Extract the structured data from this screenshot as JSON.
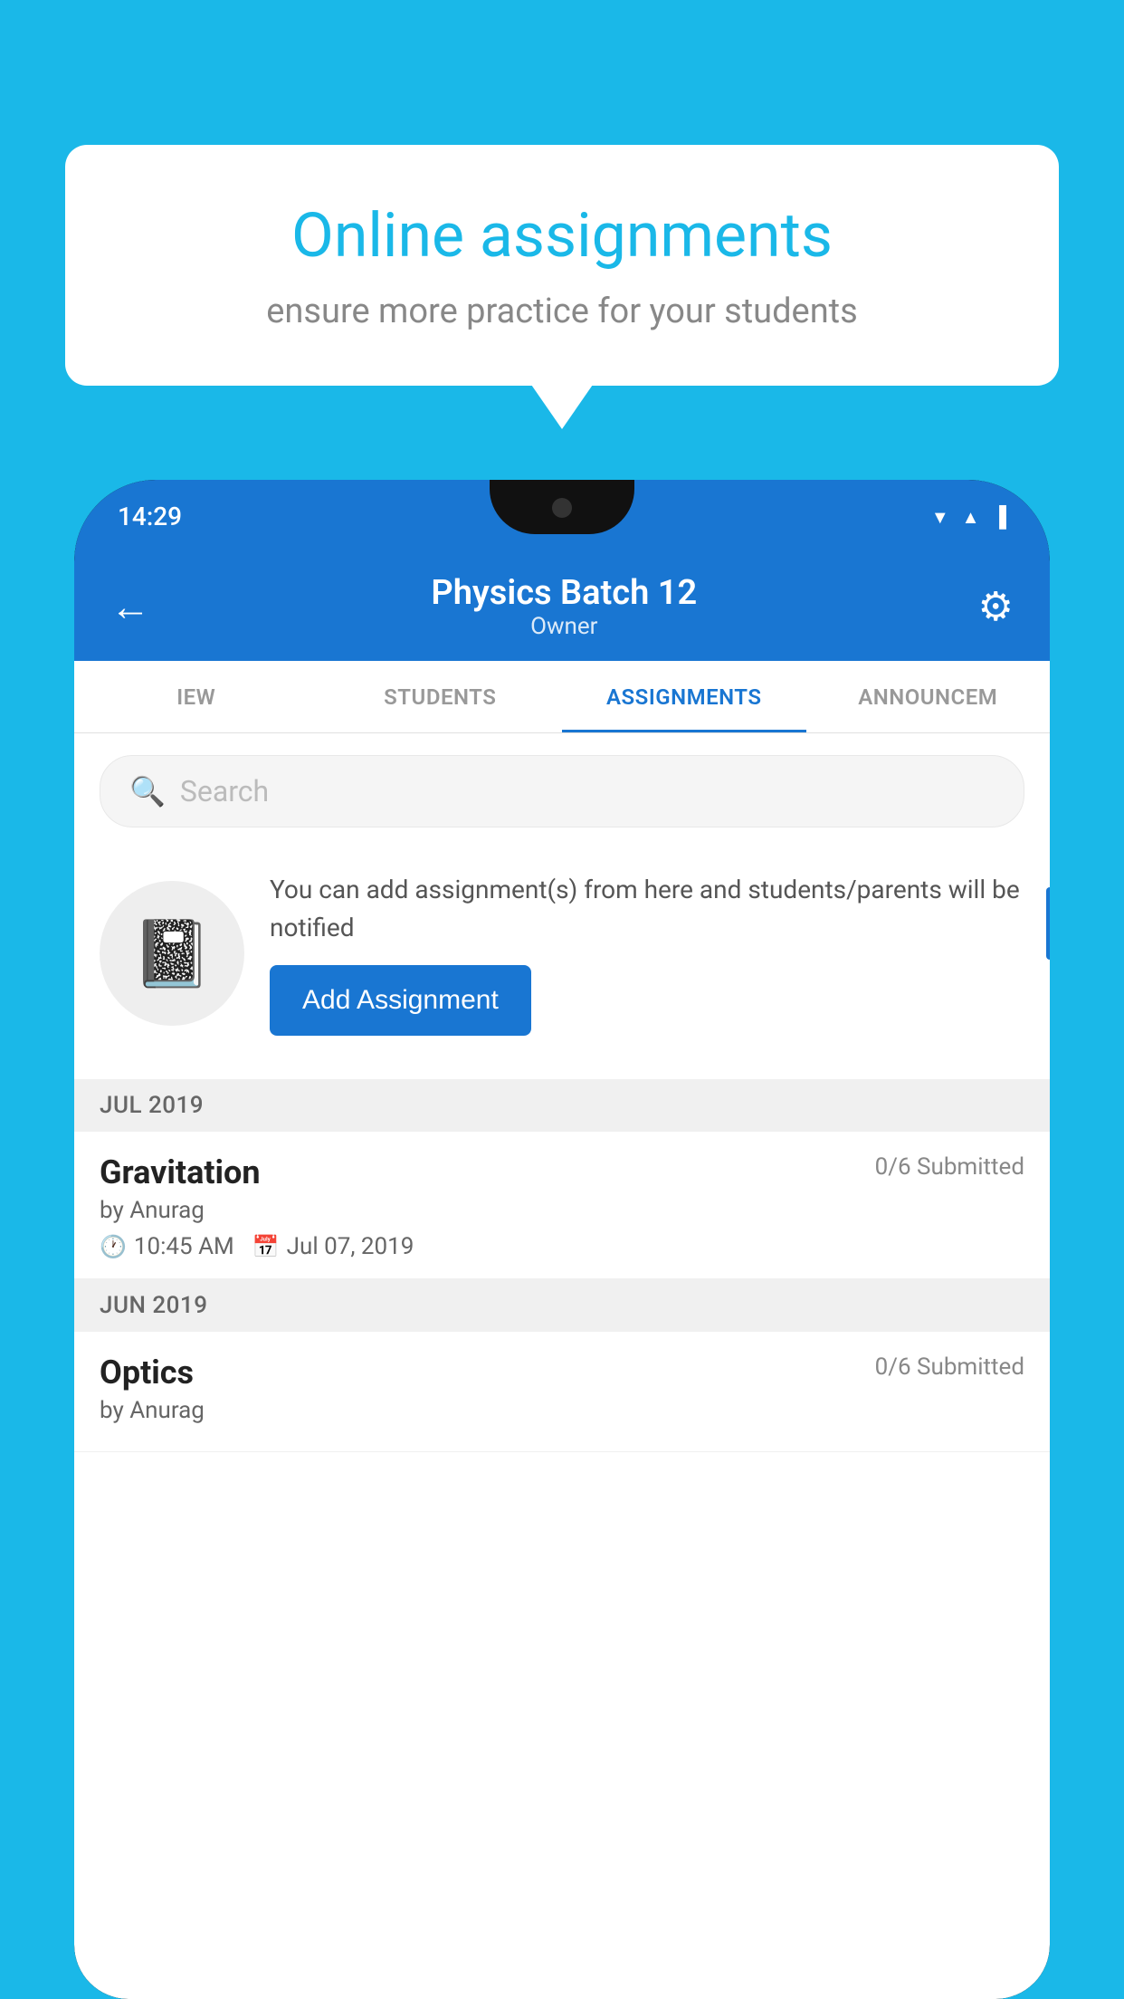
{
  "page": {
    "background_color": "#1ab8e8"
  },
  "speech_bubble": {
    "title": "Online assignments",
    "subtitle": "ensure more practice for your students"
  },
  "phone": {
    "status_bar": {
      "time": "14:29",
      "icons": [
        "wifi",
        "signal",
        "battery"
      ]
    },
    "header": {
      "title": "Physics Batch 12",
      "subtitle": "Owner",
      "back_label": "←",
      "gear_label": "⚙"
    },
    "tabs": [
      {
        "label": "IEW",
        "active": false
      },
      {
        "label": "STUDENTS",
        "active": false
      },
      {
        "label": "ASSIGNMENTS",
        "active": true
      },
      {
        "label": "ANNOUNCEM",
        "active": false
      }
    ],
    "search": {
      "placeholder": "Search"
    },
    "promo": {
      "icon": "📓",
      "description": "You can add assignment(s) from here and students/parents will be notified",
      "button_label": "Add Assignment"
    },
    "sections": [
      {
        "header": "JUL 2019",
        "assignments": [
          {
            "name": "Gravitation",
            "submitted": "0/6 Submitted",
            "by": "by Anurag",
            "time": "10:45 AM",
            "date": "Jul 07, 2019"
          }
        ]
      },
      {
        "header": "JUN 2019",
        "assignments": [
          {
            "name": "Optics",
            "submitted": "0/6 Submitted",
            "by": "by Anurag",
            "time": "",
            "date": ""
          }
        ]
      }
    ]
  }
}
